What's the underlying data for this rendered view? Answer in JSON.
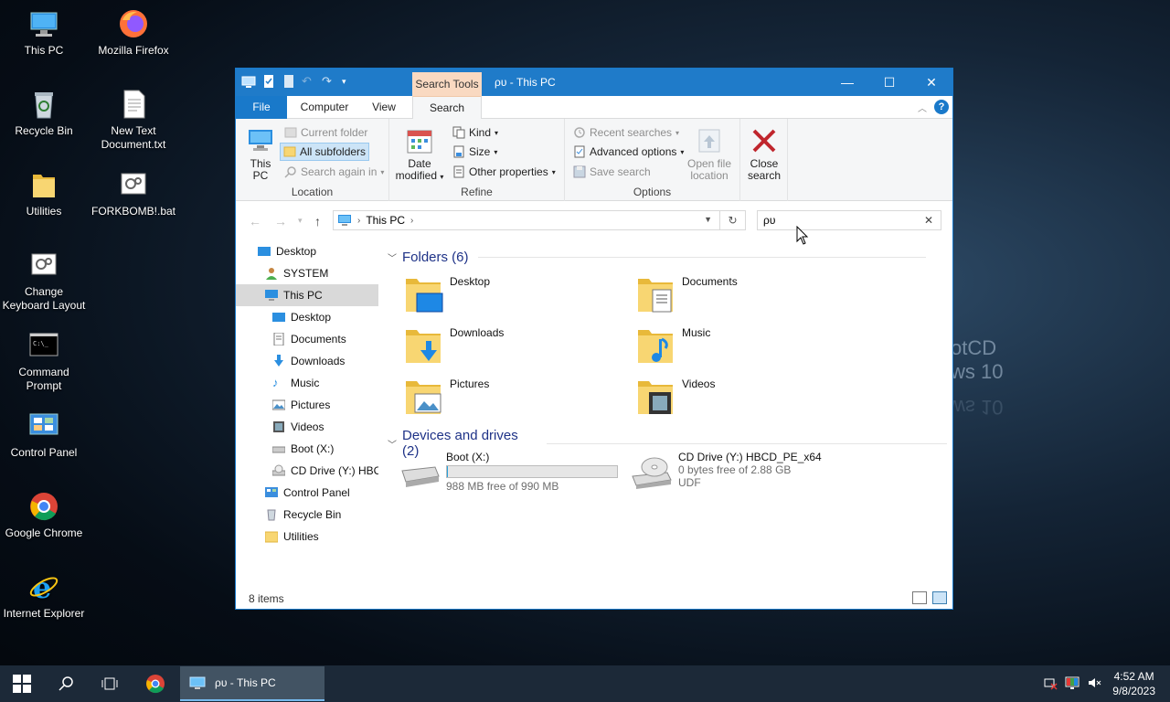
{
  "background": {
    "watermark_line1": "otCD",
    "watermark_line2": "ws 10",
    "watermark_reflection": "ws 10"
  },
  "desktop": {
    "icons": [
      {
        "label": "This PC",
        "icon": "computer-icon"
      },
      {
        "label": "Mozilla Firefox",
        "icon": "firefox-icon"
      },
      {
        "label": "Recycle Bin",
        "icon": "recycle-bin-icon"
      },
      {
        "label": "New Text Document.txt",
        "icon": "text-file-icon"
      },
      {
        "label": "Utilities",
        "icon": "folder-icon"
      },
      {
        "label": "FORKBOMB!.bat",
        "icon": "batch-file-icon"
      },
      {
        "label": "Change Keyboard Layout",
        "icon": "gear-file-icon"
      },
      {
        "label": "Command Prompt",
        "icon": "cmd-icon"
      },
      {
        "label": "Control Panel",
        "icon": "control-panel-icon"
      },
      {
        "label": "Google Chrome",
        "icon": "chrome-icon"
      },
      {
        "label": "Internet Explorer",
        "icon": "ie-icon"
      }
    ]
  },
  "window": {
    "title": "ρυ - This PC",
    "contextual_tab": "Search Tools",
    "controls": {
      "minimize": "—",
      "maximize": "☐",
      "close": "✕"
    },
    "tabs": {
      "file": "File",
      "computer": "Computer",
      "view": "View",
      "search": "Search"
    },
    "ribbon": {
      "location": {
        "label": "Location",
        "this_pc": "This PC",
        "current_folder": "Current folder",
        "all_subfolders": "All subfolders",
        "search_again": "Search again in"
      },
      "refine": {
        "label": "Refine",
        "date_modified": "Date modified",
        "kind": "Kind",
        "size": "Size",
        "other_properties": "Other properties"
      },
      "options": {
        "label": "Options",
        "recent_searches": "Recent searches",
        "advanced_options": "Advanced options",
        "save_search": "Save search",
        "open_file_location": "Open file location"
      },
      "close_search": "Close search"
    },
    "address": {
      "path": "This PC"
    },
    "search": {
      "value": "ρυ"
    },
    "nav": {
      "items": [
        {
          "label": "Desktop",
          "icon": "desktop-icon"
        },
        {
          "label": "SYSTEM",
          "icon": "user-icon"
        },
        {
          "label": "This PC",
          "icon": "computer-icon"
        },
        {
          "label": "Desktop",
          "icon": "desktop-icon"
        },
        {
          "label": "Documents",
          "icon": "documents-icon"
        },
        {
          "label": "Downloads",
          "icon": "downloads-icon"
        },
        {
          "label": "Music",
          "icon": "music-icon"
        },
        {
          "label": "Pictures",
          "icon": "pictures-icon"
        },
        {
          "label": "Videos",
          "icon": "videos-icon"
        },
        {
          "label": "Boot (X:)",
          "icon": "drive-icon"
        },
        {
          "label": "CD Drive (Y:) HBC",
          "icon": "cd-drive-icon"
        },
        {
          "label": "Control Panel",
          "icon": "control-panel-icon"
        },
        {
          "label": "Recycle Bin",
          "icon": "recycle-bin-icon"
        },
        {
          "label": "Utilities",
          "icon": "folder-icon"
        }
      ]
    },
    "content": {
      "folders_header": "Folders (6)",
      "folders": [
        {
          "name": "Desktop",
          "icon": "desktop-folder-icon"
        },
        {
          "name": "Documents",
          "icon": "documents-folder-icon"
        },
        {
          "name": "Downloads",
          "icon": "downloads-folder-icon"
        },
        {
          "name": "Music",
          "icon": "music-folder-icon"
        },
        {
          "name": "Pictures",
          "icon": "pictures-folder-icon"
        },
        {
          "name": "Videos",
          "icon": "videos-folder-icon"
        }
      ],
      "drives_header": "Devices and drives (2)",
      "drives": [
        {
          "name": "Boot (X:)",
          "free": "988 MB free of 990 MB",
          "used_fraction": 0.002,
          "icon": "hard-drive-icon"
        },
        {
          "name": "CD Drive (Y:) HBCD_PE_x64",
          "free": "0 bytes free of 2.88 GB",
          "fs": "UDF",
          "icon": "cd-drive-icon"
        }
      ]
    },
    "status": {
      "count": "8 items"
    }
  },
  "taskbar": {
    "explorer_label": "ρυ - This PC",
    "time": "4:52 AM",
    "date": "9/8/2023"
  }
}
